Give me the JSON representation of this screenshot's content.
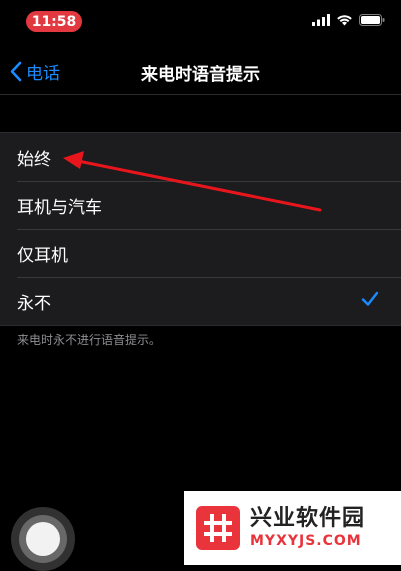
{
  "status_bar": {
    "time": "11:58"
  },
  "nav": {
    "back_label": "电话",
    "title": "来电时语音提示"
  },
  "options": [
    {
      "label": "始终",
      "selected": false
    },
    {
      "label": "耳机与汽车",
      "selected": false
    },
    {
      "label": "仅耳机",
      "selected": false
    },
    {
      "label": "永不",
      "selected": true
    }
  ],
  "footer_note": "来电时永不进行语音提示。",
  "watermark": {
    "name": "兴业软件园",
    "url": "MYXYJS.COM"
  },
  "colors": {
    "accent": "#1a8cff",
    "time_pill": "#e2383f",
    "annotation": "#e8161c",
    "watermark_red": "#e8343a"
  },
  "icons": [
    "signal-icon",
    "wifi-icon",
    "battery-icon",
    "chevron-left-icon",
    "checkmark-icon",
    "assistive-touch-icon"
  ]
}
